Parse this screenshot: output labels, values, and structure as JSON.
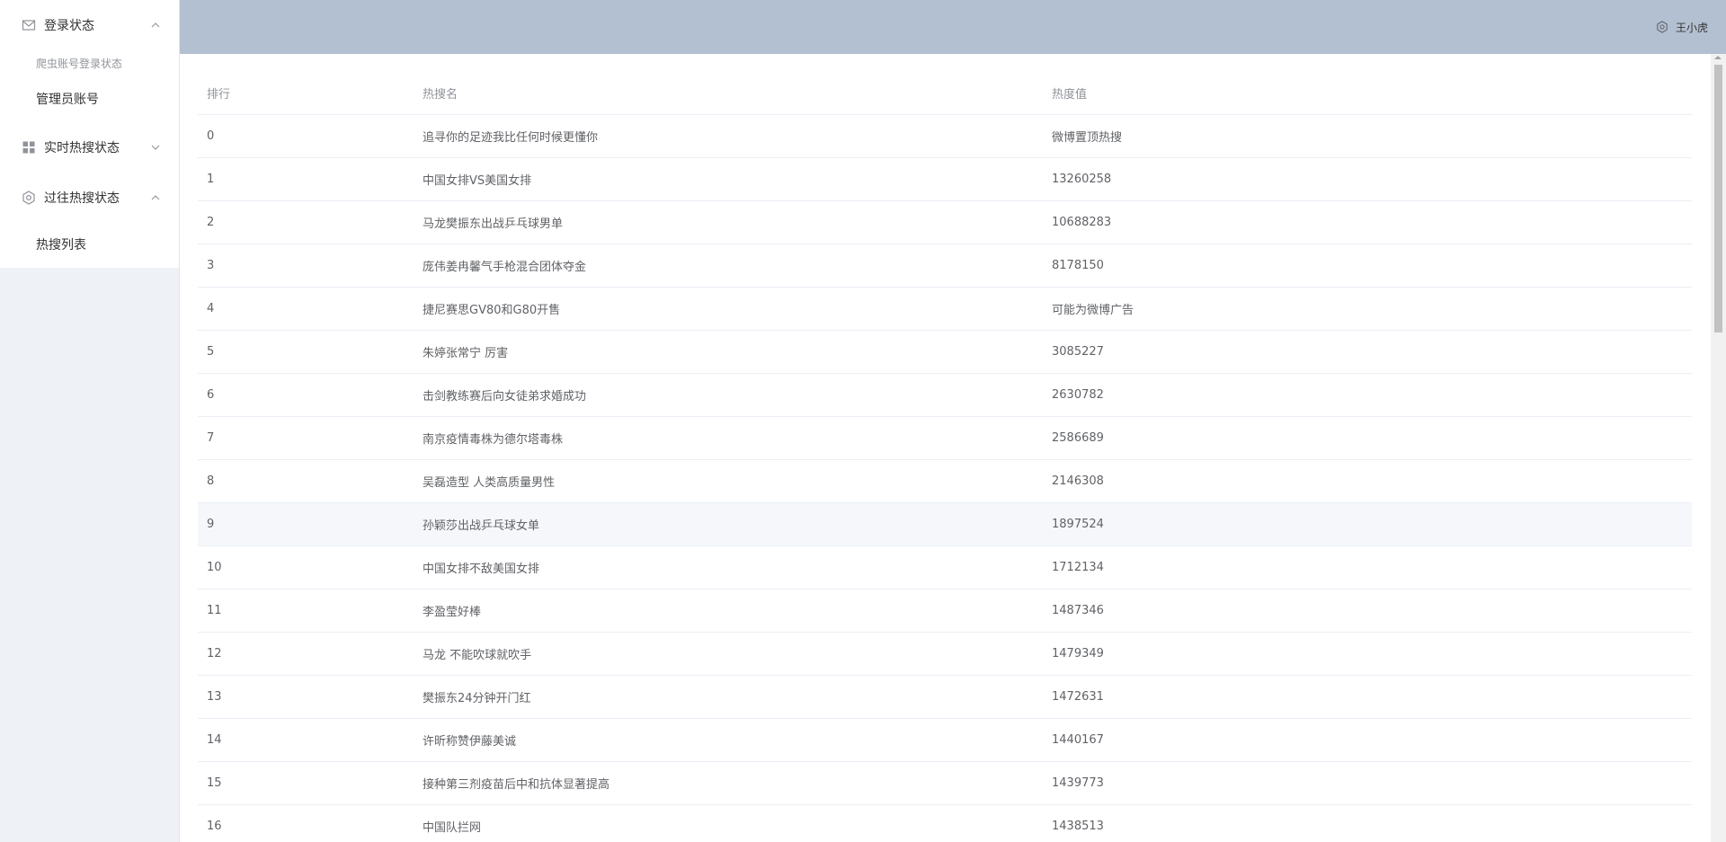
{
  "sidebar": {
    "menus": [
      {
        "title": "登录状态",
        "icon": "envelope-icon",
        "expanded": true,
        "group_title": "爬虫账号登录状态",
        "items": [
          {
            "label": "管理员账号"
          }
        ]
      },
      {
        "title": "实时热搜状态",
        "icon": "grid-icon",
        "expanded": false,
        "items": []
      },
      {
        "title": "过往热搜状态",
        "icon": "gear-icon",
        "expanded": true,
        "items": [
          {
            "label": "热搜列表"
          }
        ]
      }
    ]
  },
  "header": {
    "user_name": "王小虎",
    "settings_icon": "gear-icon",
    "background": "#b3c0d1"
  },
  "table": {
    "columns": [
      "排行",
      "热搜名",
      "热度值"
    ],
    "hover_row": 9,
    "rows": [
      {
        "rank": "0",
        "name": "追寻你的足迹我比任何时候更懂你",
        "value": "微博置顶热搜"
      },
      {
        "rank": "1",
        "name": "中国女排VS美国女排",
        "value": "13260258"
      },
      {
        "rank": "2",
        "name": "马龙樊振东出战乒乓球男单",
        "value": "10688283"
      },
      {
        "rank": "3",
        "name": "庞伟姜冉馨气手枪混合团体夺金",
        "value": "8178150"
      },
      {
        "rank": "4",
        "name": "捷尼赛思GV80和G80开售",
        "value": "可能为微博广告"
      },
      {
        "rank": "5",
        "name": "朱婷张常宁 厉害",
        "value": "3085227"
      },
      {
        "rank": "6",
        "name": "击剑教练赛后向女徒弟求婚成功",
        "value": "2630782"
      },
      {
        "rank": "7",
        "name": "南京疫情毒株为德尔塔毒株",
        "value": "2586689"
      },
      {
        "rank": "8",
        "name": "吴磊造型 人类高质量男性",
        "value": "2146308"
      },
      {
        "rank": "9",
        "name": "孙颖莎出战乒乓球女单",
        "value": "1897524"
      },
      {
        "rank": "10",
        "name": "中国女排不敌美国女排",
        "value": "1712134"
      },
      {
        "rank": "11",
        "name": "李盈莹好棒",
        "value": "1487346"
      },
      {
        "rank": "12",
        "name": "马龙 不能吹球就吹手",
        "value": "1479349"
      },
      {
        "rank": "13",
        "name": "樊振东24分钟开门红",
        "value": "1472631"
      },
      {
        "rank": "14",
        "name": "许昕称赞伊藤美诚",
        "value": "1440167"
      },
      {
        "rank": "15",
        "name": "接种第三剂疫苗后中和抗体显著提高",
        "value": "1439773"
      },
      {
        "rank": "16",
        "name": "中国队拦网",
        "value": "1438513"
      }
    ]
  }
}
